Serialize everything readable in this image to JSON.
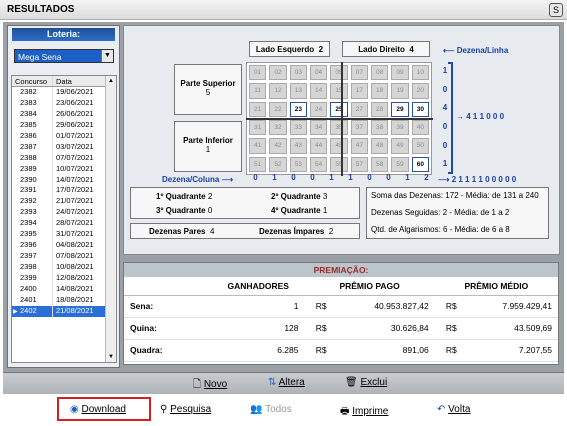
{
  "window": {
    "title": "RESULTADOS",
    "close": "S"
  },
  "loteria": {
    "label": "Loteria:",
    "selected": "Mega Sena"
  },
  "concursos": {
    "headers": [
      "Concurso",
      "Data"
    ],
    "rows": [
      [
        "2382",
        "19/06/2021"
      ],
      [
        "2383",
        "23/06/2021"
      ],
      [
        "2384",
        "26/06/2021"
      ],
      [
        "2385",
        "29/06/2021"
      ],
      [
        "2386",
        "01/07/2021"
      ],
      [
        "2387",
        "03/07/2021"
      ],
      [
        "2388",
        "07/07/2021"
      ],
      [
        "2389",
        "10/07/2021"
      ],
      [
        "2390",
        "14/07/2021"
      ],
      [
        "2391",
        "17/07/2021"
      ],
      [
        "2392",
        "21/07/2021"
      ],
      [
        "2393",
        "24/07/2021"
      ],
      [
        "2394",
        "28/07/2021"
      ],
      [
        "2395",
        "31/07/2021"
      ],
      [
        "2396",
        "04/08/2021"
      ],
      [
        "2397",
        "07/08/2021"
      ],
      [
        "2398",
        "10/08/2021"
      ],
      [
        "2399",
        "12/08/2021"
      ],
      [
        "2400",
        "14/08/2021"
      ],
      [
        "2401",
        "18/08/2021"
      ],
      [
        "2402",
        "21/08/2021"
      ]
    ]
  },
  "labels": {
    "lado_esquerdo": "Lado Esquerdo",
    "lado_esquerdo_val": "2",
    "lado_direito": "Lado Direito",
    "lado_direito_val": "4",
    "dezena_linha": "Dezena/Linha",
    "dezena_coluna": "Dezena/Coluna",
    "parte_superior": "Parte Superior",
    "parte_superior_val": "5",
    "parte_inferior": "Parte Inferior",
    "parte_inferior_val": "1",
    "q1": "1º Quadrante",
    "q1v": "2",
    "q2": "2º Quadrante",
    "q2v": "3",
    "q3": "3º Quadrante",
    "q3v": "0",
    "q4": "4º Quadrante",
    "q4v": "1",
    "pares": "Dezenas Pares",
    "pares_val": "4",
    "impares": "Dezenas Ímpares",
    "impares_val": "2",
    "soma": "Soma das Dezenas: 172 - Média: de 131 a 240",
    "seguidas": "Dezenas Seguidas: 2 - Média: de 1 a 2",
    "algarismos": "Qtd. de Algarismos: 6 - Média: de 6 a 8",
    "linha_sum": "4 1 1 0 0 0",
    "coluna_sum": "2 1 1 1 1 0 0 0 0 0"
  },
  "line_counts": [
    "1",
    "0",
    "4",
    "0",
    "0",
    "1"
  ],
  "col_counts": [
    "0",
    "1",
    "0",
    "0",
    "1",
    "1",
    "0",
    "0",
    "1",
    "2"
  ],
  "premiacao": {
    "title": "PREMIAÇÃO:",
    "headers": [
      "GANHADORES",
      "PRÊMIO PAGO",
      "PRÊMIO MÉDIO"
    ],
    "rows": [
      {
        "label": "Sena:",
        "g": "1",
        "cur1": "R$",
        "pago": "40.953.827,42",
        "cur2": "R$",
        "medio": "7.959.429,41"
      },
      {
        "label": "Quina:",
        "g": "128",
        "cur1": "R$",
        "pago": "30.626,84",
        "cur2": "R$",
        "medio": "43.509,69"
      },
      {
        "label": "Quadra:",
        "g": "6.285",
        "cur1": "R$",
        "pago": "891,06",
        "cur2": "R$",
        "medio": "7.207,55"
      }
    ]
  },
  "toolbar1": {
    "novo": "Novo",
    "altera": "Altera",
    "exclui": "Exclui"
  },
  "toolbar2": {
    "download": "Download",
    "pesquisa": "Pesquisa",
    "todos": "Todos",
    "imprime": "Imprime",
    "volta": "Volta"
  }
}
